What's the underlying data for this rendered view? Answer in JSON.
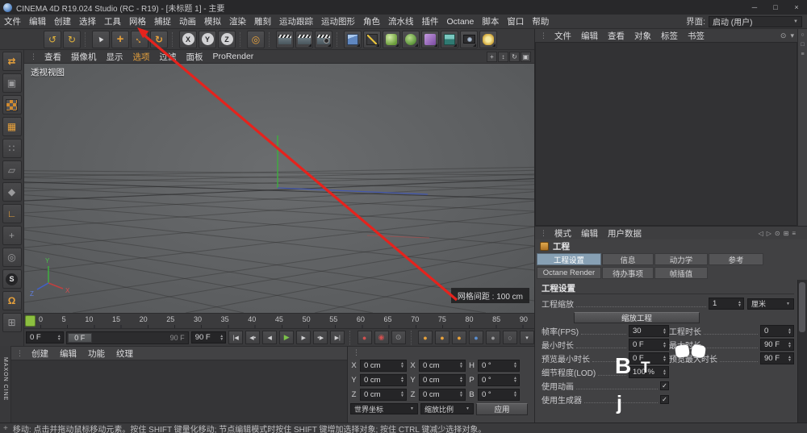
{
  "window": {
    "title": "CINEMA 4D R19.024 Studio (RC - R19) - [未标题 1] - 主要",
    "controls": [
      "─",
      "□",
      "×"
    ]
  },
  "menubar": {
    "items": [
      "文件",
      "编辑",
      "创建",
      "选择",
      "工具",
      "网格",
      "捕捉",
      "动画",
      "模拟",
      "渲染",
      "雕刻",
      "运动跟踪",
      "运动图形",
      "角色",
      "流水线",
      "插件",
      "Octane",
      "脚本",
      "窗口",
      "帮助"
    ],
    "interface_label": "界面:",
    "interface_value": "启动 (用户)",
    "caret": "▼"
  },
  "toolbar": {
    "undo": "↺",
    "redo": "↻",
    "live_selection": "▲",
    "move": "+",
    "scale": "↔",
    "rotate": "↻",
    "axis_x": "X",
    "axis_y": "Y",
    "axis_z": "Z",
    "coord_system": "◎",
    "shape_icons": [
      "render-view",
      "render-picture-viewer",
      "render-settings",
      "cube-primitive",
      "spline-pen",
      "subdivision-surface",
      "array-generator",
      "deformer",
      "environment-floor",
      "camera",
      "light"
    ]
  },
  "left_toolbar": {
    "convert": "⇄",
    "model": "▣",
    "workplane": "▦",
    "points": "∷",
    "edges": "▱",
    "polygons": "◆",
    "axis": "∟",
    "enable_axis": "+",
    "solo": "◎",
    "snap": "S",
    "magnet": "Ω",
    "lock": "⊞",
    "shape_icons": [
      "texture-mode"
    ],
    "brand": "MAXON CINE"
  },
  "viewport": {
    "grip": "⋮",
    "menu": [
      "查看",
      "摄像机",
      "显示",
      "选项",
      "过滤",
      "面板",
      "ProRender"
    ],
    "controls": {
      "pan": "+",
      "zoom": "↕",
      "rotate": "↻",
      "layout": "▣"
    },
    "view_label": "透视视图",
    "grid_label": "网格间距 : 100 cm",
    "axis": {
      "x": "X",
      "y": "Y",
      "z": "Z"
    }
  },
  "timeline": {
    "frames": [
      "0",
      "5",
      "10",
      "15",
      "20",
      "25",
      "30",
      "35",
      "40",
      "45",
      "50",
      "55",
      "60",
      "65",
      "70",
      "75",
      "80",
      "85",
      "90"
    ]
  },
  "anim": {
    "start_field": "0 F",
    "end_field": "90 F",
    "slider_handle": "0 F",
    "slider_end": "90 F",
    "transport": {
      "goto_start": "|◀",
      "prev_key": "◀•",
      "prev_frame": "◀",
      "play": "▶",
      "next_frame": "▶",
      "next_key": "•▶",
      "goto_end": "▶|"
    },
    "record": {
      "record": "●",
      "autokey": "◉",
      "key_selection": "⊙",
      "position": "●",
      "scale": "●",
      "rotation": "●",
      "parameter": "●",
      "pla": "●",
      "solo": "○",
      "more": "▾"
    }
  },
  "materials": {
    "grip": "⋮",
    "menu": [
      "创建",
      "编辑",
      "功能",
      "纹理"
    ]
  },
  "coordinates": {
    "grip": "⋮",
    "rows": [
      {
        "c1": "X",
        "v1": "0 cm",
        "c2": "X",
        "v2": "0 cm",
        "c3": "H",
        "v3": "0 °"
      },
      {
        "c1": "Y",
        "v1": "0 cm",
        "c2": "Y",
        "v2": "0 cm",
        "c3": "P",
        "v3": "0 °"
      },
      {
        "c1": "Z",
        "v1": "0 cm",
        "c2": "Z",
        "v2": "0 cm",
        "c3": "B",
        "v3": "0 °"
      }
    ],
    "space_dropdown": "世界坐标",
    "mode_dropdown": "缩放比例",
    "apply_button": "应用",
    "caret": "▼"
  },
  "object_manager": {
    "grip": "⋮",
    "menu": [
      "文件",
      "编辑",
      "查看",
      "对象",
      "标签",
      "书签"
    ],
    "side_icons": [
      "○",
      "□",
      "≡"
    ],
    "header_icons": [
      "⊙",
      "▾"
    ]
  },
  "attributes": {
    "grip": "⋮",
    "menu": [
      "模式",
      "编辑",
      "用户数据"
    ],
    "header_icons": [
      "◁",
      "▷",
      "⊙",
      "⊞",
      "≡"
    ],
    "object_label": "工程",
    "tabs_row1": [
      "工程设置",
      "信息",
      "动力学",
      "参考"
    ],
    "tabs_row2": [
      "Octane Render",
      "待办事项",
      "帧插值"
    ],
    "section_title": "工程设置",
    "scale_label": "工程缩放",
    "scale_value": "1",
    "scale_unit": "厘米",
    "scale_button": "缩放工程",
    "rows_left": [
      {
        "label": "帧率(FPS)",
        "value": "30"
      },
      {
        "label": "最小时长",
        "value": "0 F"
      },
      {
        "label": "预览最小时长",
        "value": "0 F"
      },
      {
        "label": "细节程度(LOD)",
        "value": "100 %"
      }
    ],
    "rows_right": [
      {
        "label": "工程时长",
        "value": "0"
      },
      {
        "label": "最大时长",
        "value": "90 F"
      },
      {
        "label": "预览最大时长",
        "value": "90 F"
      }
    ],
    "checks": [
      {
        "label": "使用动画",
        "state": "✓"
      },
      {
        "label": "使用生成器",
        "state": "✓"
      }
    ]
  },
  "status": {
    "icon": "+",
    "text": "移动: 点击并拖动鼠标移动元素。按住 SHIFT 键量化移动; 节点编辑模式时按住 SHIFT 键增加选择对象; 按住 CTRL 键减少选择对象。"
  },
  "watermark": {
    "b": "B",
    "t": "T",
    "j": "j"
  },
  "colors": {
    "accent": "#e8a23c",
    "tab_active": "#87a0b4",
    "play": "#7cc24a",
    "annotation": "#e5231d",
    "marker": "#8cbf40"
  }
}
